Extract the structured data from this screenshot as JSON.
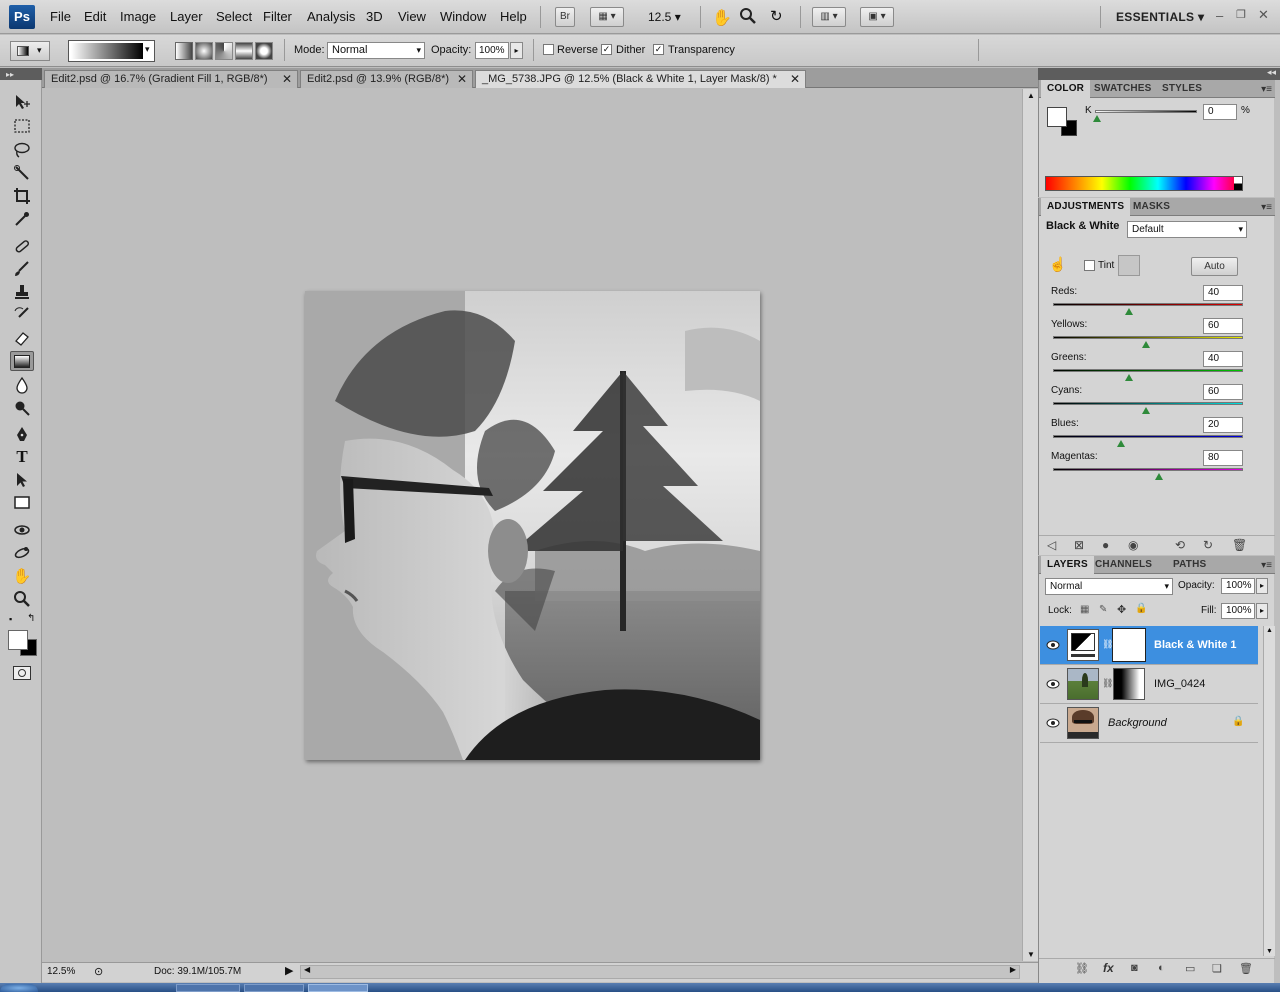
{
  "menubar": {
    "items": [
      "File",
      "Edit",
      "Image",
      "Layer",
      "Select",
      "Filter",
      "Analysis",
      "3D",
      "View",
      "Window",
      "Help"
    ],
    "bridge_label": "Br",
    "zoom": "12.5",
    "workspace": "ESSENTIALS"
  },
  "options": {
    "mode_label": "Mode:",
    "mode_value": "Normal",
    "opacity_label": "Opacity:",
    "opacity_value": "100%",
    "reverse_label": "Reverse",
    "dither_label": "Dither",
    "transparency_label": "Transparency",
    "reverse_checked": false,
    "dither_checked": true,
    "transparency_checked": true
  },
  "tabs": [
    {
      "label": "Edit2.psd @ 16.7% (Gradient Fill 1, RGB/8*)"
    },
    {
      "label": "Edit2.psd @ 13.9% (RGB/8*)"
    },
    {
      "label": "_MG_5738.JPG @ 12.5% (Black & White 1, Layer Mask/8) *"
    }
  ],
  "status": {
    "zoom": "12.5%",
    "doc": "Doc: 39.1M/105.7M"
  },
  "color_panel": {
    "tabs": [
      "COLOR",
      "SWATCHES",
      "STYLES"
    ],
    "channel": "K",
    "value": "0",
    "unit": "%"
  },
  "adjustments_panel": {
    "tabs": [
      "ADJUSTMENTS",
      "MASKS"
    ],
    "title": "Black & White",
    "preset": "Default",
    "tint_label": "Tint",
    "auto_label": "Auto",
    "sliders": [
      {
        "label": "Reds:",
        "value": "40",
        "fraction": 0.4,
        "track": "linear-gradient(90deg,#000,#e00000)"
      },
      {
        "label": "Yellows:",
        "value": "60",
        "fraction": 0.49,
        "track": "linear-gradient(90deg,#000,#e8e800)"
      },
      {
        "label": "Greens:",
        "value": "40",
        "fraction": 0.4,
        "track": "linear-gradient(90deg,#000,#00c800)"
      },
      {
        "label": "Cyans:",
        "value": "60",
        "fraction": 0.49,
        "track": "linear-gradient(90deg,#000,#00e0e0)"
      },
      {
        "label": "Blues:",
        "value": "20",
        "fraction": 0.36,
        "track": "linear-gradient(90deg,#000,#0000e0)"
      },
      {
        "label": "Magentas:",
        "value": "80",
        "fraction": 0.56,
        "track": "linear-gradient(90deg,#000,#e000e0)"
      }
    ]
  },
  "layers_panel": {
    "tabs": [
      "LAYERS",
      "CHANNELS",
      "PATHS"
    ],
    "blend_mode": "Normal",
    "opacity_label": "Opacity:",
    "opacity_value": "100%",
    "lock_label": "Lock:",
    "fill_label": "Fill:",
    "fill_value": "100%",
    "layers": [
      {
        "name": "Black & White 1",
        "selected": true
      },
      {
        "name": "IMG_0424",
        "selected": false
      },
      {
        "name": "Background",
        "selected": false
      }
    ]
  },
  "colors": {
    "accent": "#3d8fe0",
    "ps_blue": "#0b3770"
  }
}
